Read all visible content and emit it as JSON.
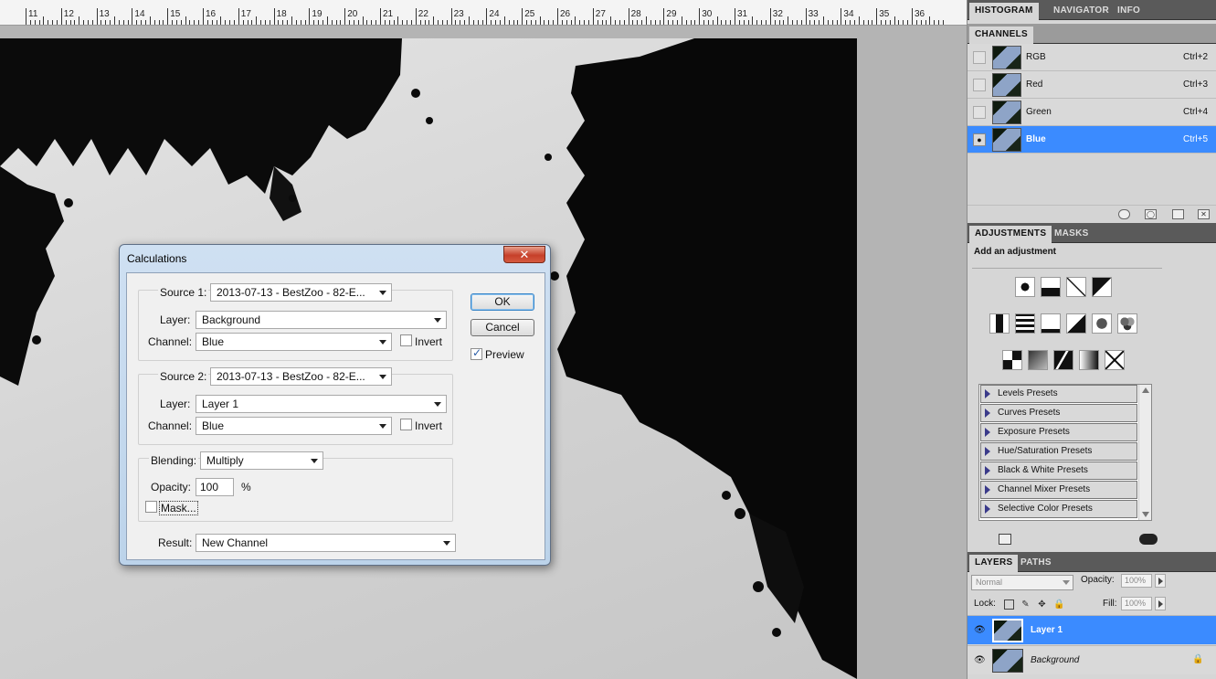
{
  "ruler": {
    "labels": [
      "11",
      "12",
      "13",
      "14",
      "15",
      "16",
      "17",
      "18",
      "19",
      "20",
      "21",
      "22",
      "23",
      "24",
      "25",
      "26",
      "27",
      "28",
      "29",
      "30",
      "31",
      "32",
      "33",
      "34",
      "35",
      "36"
    ]
  },
  "channels_tabs": [
    "HISTOGRAM",
    "NAVIGATOR",
    "INFO"
  ],
  "channels_panel": {
    "tab": "CHANNELS",
    "rows": [
      {
        "name": "RGB",
        "shortcut": "Ctrl+2"
      },
      {
        "name": "Red",
        "shortcut": "Ctrl+3"
      },
      {
        "name": "Green",
        "shortcut": "Ctrl+4"
      },
      {
        "name": "Blue",
        "shortcut": "Ctrl+5"
      }
    ]
  },
  "adjustments_panel": {
    "tabs": [
      "ADJUSTMENTS",
      "MASKS"
    ],
    "title": "Add an adjustment",
    "presets": [
      "Levels Presets",
      "Curves Presets",
      "Exposure Presets",
      "Hue/Saturation Presets",
      "Black & White Presets",
      "Channel Mixer Presets",
      "Selective Color Presets"
    ]
  },
  "layers_panel": {
    "tabs": [
      "LAYERS",
      "PATHS"
    ],
    "blend_mode": "Normal",
    "opacity_label": "Opacity:",
    "opacity_value": "100%",
    "lock_label": "Lock:",
    "fill_label": "Fill:",
    "fill_value": "100%",
    "layers": [
      {
        "name": "Layer 1"
      },
      {
        "name": "Background"
      }
    ]
  },
  "dialog": {
    "title": "Calculations",
    "close_glyph": "✕",
    "source1": {
      "label": "Source 1:",
      "file": "2013-07-13 - BestZoo - 82-E...",
      "layer_label": "Layer:",
      "layer": "Background",
      "channel_label": "Channel:",
      "channel": "Blue",
      "invert_label": "Invert"
    },
    "source2": {
      "label": "Source 2:",
      "file": "2013-07-13 - BestZoo - 82-E...",
      "layer_label": "Layer:",
      "layer": "Layer 1",
      "channel_label": "Channel:",
      "channel": "Blue",
      "invert_label": "Invert"
    },
    "blending": {
      "label": "Blending:",
      "mode": "Multiply",
      "opacity_label": "Opacity:",
      "opacity": "100",
      "percent": "%",
      "mask_label": "Mask..."
    },
    "result": {
      "label": "Result:",
      "value": "New Channel"
    },
    "ok_label": "OK",
    "cancel_label": "Cancel",
    "preview_label": "Preview"
  }
}
